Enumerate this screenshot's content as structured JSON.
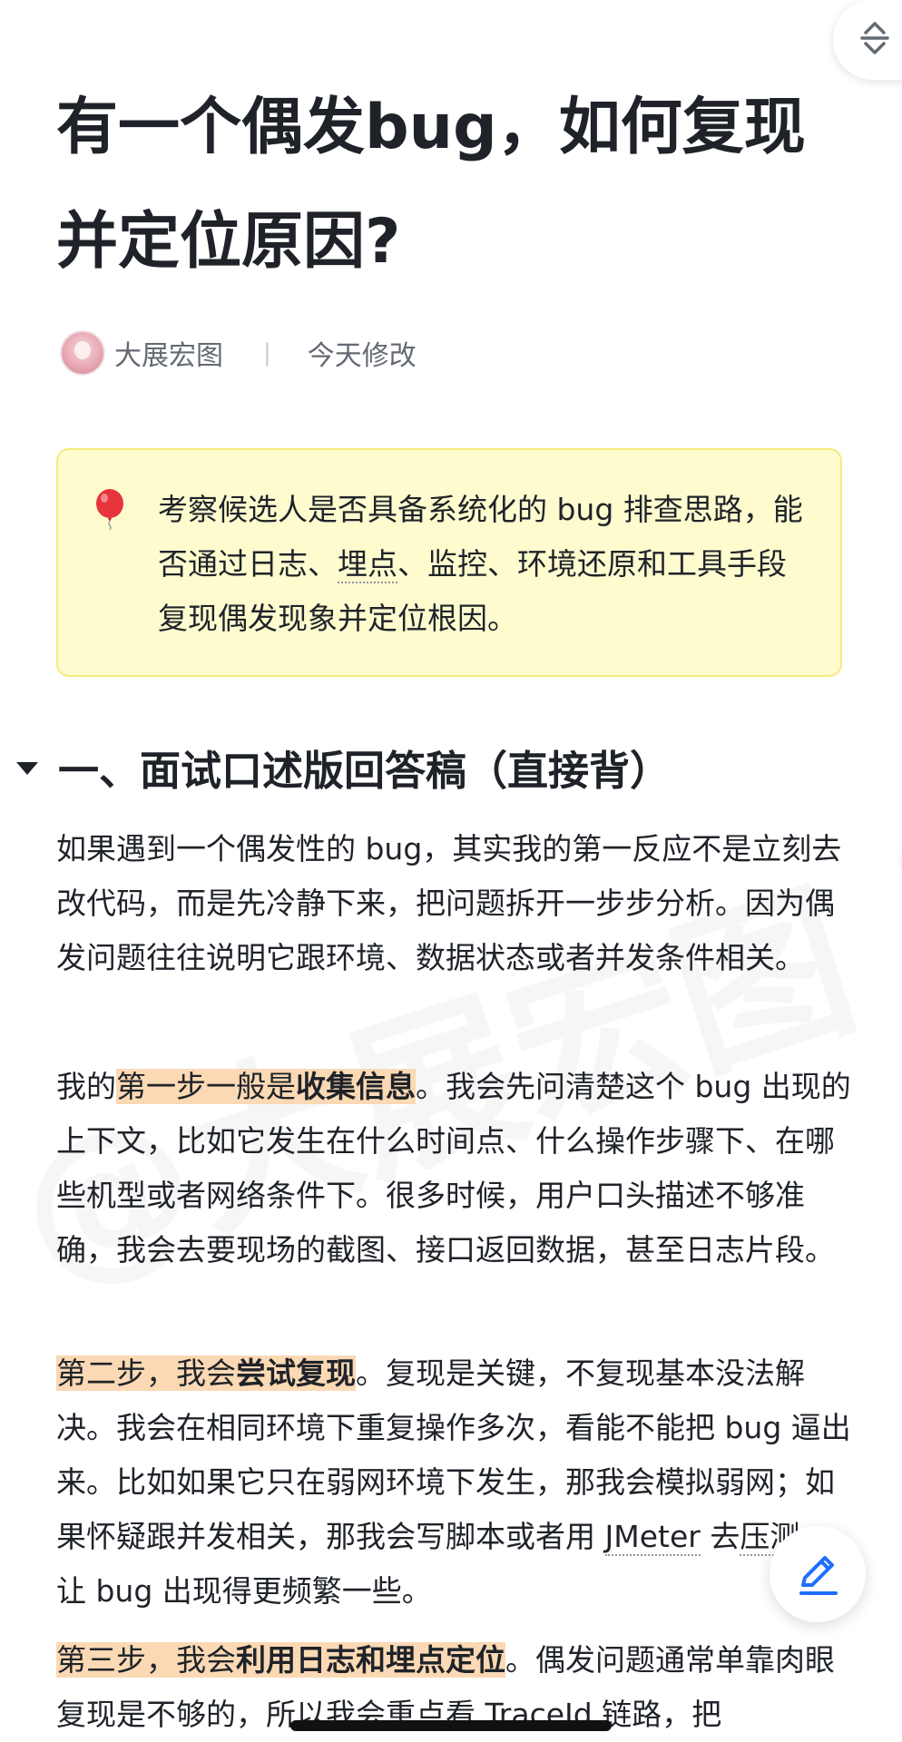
{
  "article": {
    "title": "有一个偶发bug，如何复现并定位原因?",
    "author": "大展宏图",
    "separator": "|",
    "modified": "今天修改"
  },
  "callout": {
    "icon": "balloon-icon",
    "text_part1": "考察候选人是否具备系统化的 bug 排查思路，能否通过日志、",
    "text_link": "埋点",
    "text_part2": "、监控、环境还原和工具手段复现偶发现象并定位根因。"
  },
  "section1": {
    "heading": "一、面试口述版回答稿（直接背）",
    "para1": "如果遇到一个偶发性的 bug，其实我的第一反应不是立刻去改代码，而是先冷静下来，把问题拆开一步步分析。因为偶发问题往往说明它跟环境、数据状态或者并发条件相关。",
    "para2_prefix": "我的",
    "para2_hl": "第一步一般是",
    "para2_bold": "收集信息",
    "para2_rest": "。我会先问清楚这个 bug 出现的上下文，比如它发生在什么时间点、什么操作步骤下、在哪些机型或者网络条件下。很多时候，用户口头描述不够准确，我会去要现场的截图、接口返回数据，甚至日志片段。",
    "para3_hl": "第二步，我会",
    "para3_bold": "尝试复现",
    "para3_rest1": "。复现是关键，不复现基本没法解决。我会在相同环境下重复操作多次，看能不能把 bug 逼出来。比如如果它只在弱网环境下发生，那我会模拟弱网；如果怀疑跟并发相关，那我会写脚本或者用 ",
    "para3_link1": "JMeter",
    "para3_mid": " 去",
    "para3_link2": "压测",
    "para3_rest2": "，让 bug 出现得更频繁一些。",
    "para4_hl": "第三步，我会",
    "para4_bold": "利用日志和埋点定位",
    "para4_rest": "。偶发问题通常单靠肉眼复现是不够的，所以我会重点看 TraceId 链路，把"
  },
  "watermark": "@大展宏图 原创",
  "colors": {
    "highlight": "#fbd9b4",
    "callout_bg": "#fefbcf",
    "callout_border": "#f5ea7b",
    "accent_blue": "#1e6fff"
  }
}
